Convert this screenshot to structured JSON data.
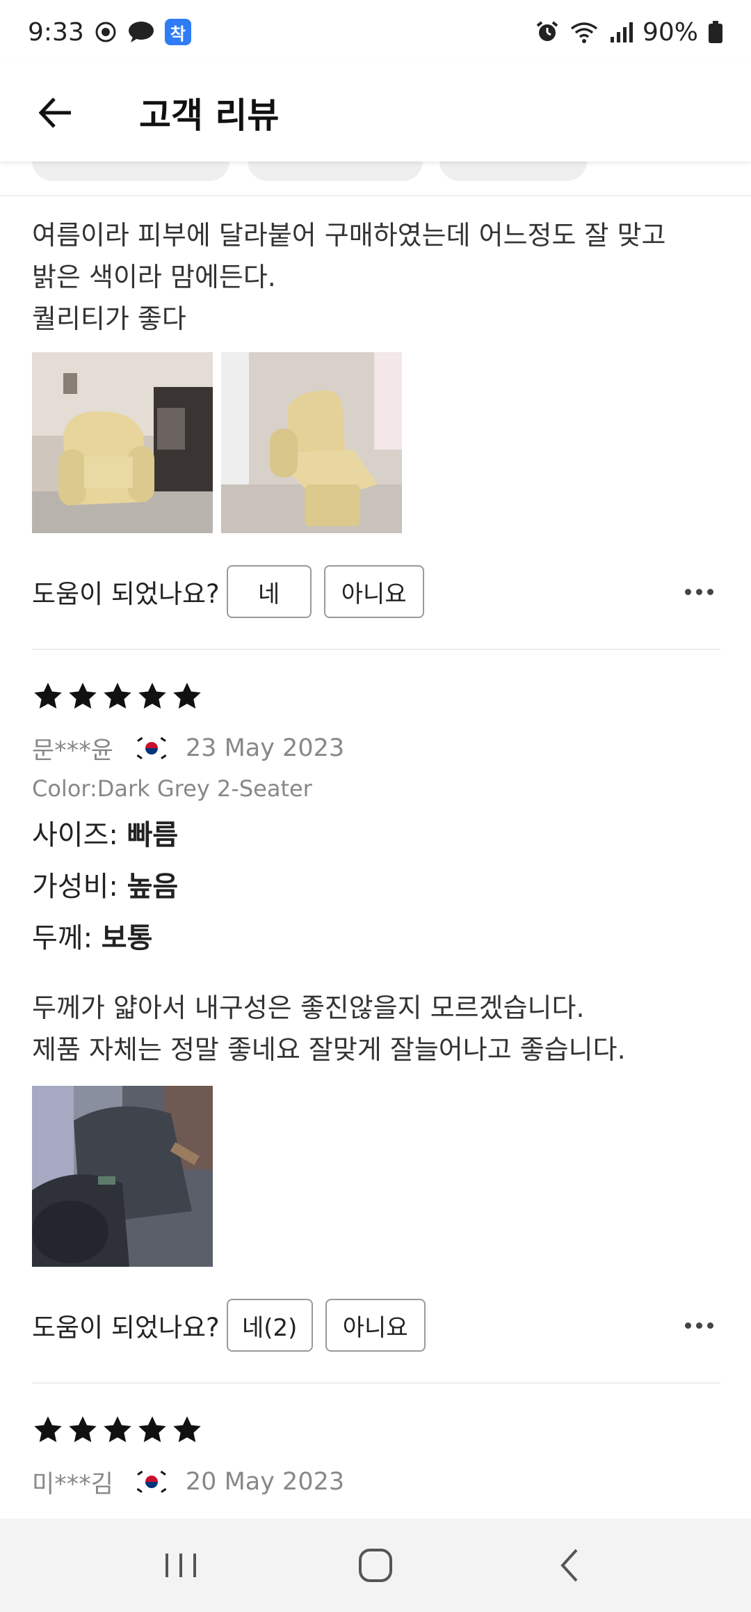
{
  "status_bar": {
    "time": "9:33",
    "badge_text": "착",
    "battery": "90%"
  },
  "header": {
    "title": "고객 리뷰",
    "back_icon": "arrow-left-icon"
  },
  "review1": {
    "text": "여름이라 피부에 달라붙어 구매하였는데  어느정도 잘 맞고\n밝은 색이라 맘에든다.\n퀄리티가 좋다",
    "helpful_label": "도움이 되었나요?",
    "yes_label": "네",
    "no_label": "아니요"
  },
  "review2": {
    "rating": 5,
    "author": "문***윤",
    "date": "23 May 2023",
    "color": "Color:Dark Grey 2-Seater",
    "attributes": [
      {
        "label": "사이즈: ",
        "value": "빠름"
      },
      {
        "label": "가성비: ",
        "value": "높음"
      },
      {
        "label": "두께: ",
        "value": "보통"
      }
    ],
    "text": "두께가 얇아서 내구성은 좋진않을지 모르겠습니다.\n제품 자체는 정말 좋네요 잘맞게 잘늘어나고 좋습니다.",
    "helpful_label": "도움이 되었나요?",
    "yes_label": "네(2)",
    "no_label": "아니요"
  },
  "review3": {
    "rating": 5,
    "author": "미***김",
    "date": "20 May 2023"
  },
  "colors": {
    "star": "#111111",
    "muted_text": "#888888",
    "divider": "#ededed"
  }
}
